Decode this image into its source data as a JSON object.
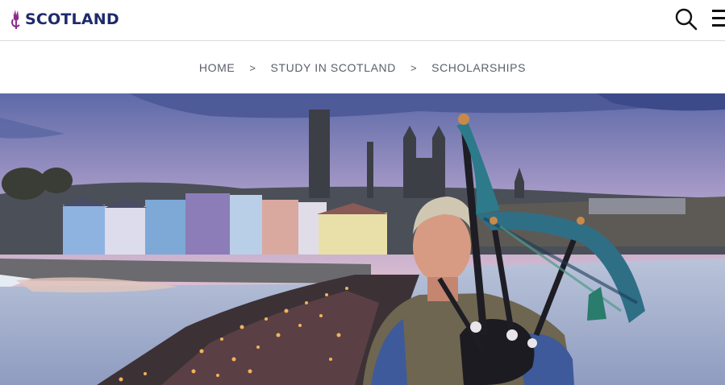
{
  "header": {
    "logo_text": "SCOTLAND",
    "brand_color": "#1f2a6b",
    "thistle_color": "#8b2c8f",
    "search_icon": "search-icon",
    "menu_icon": "hamburger-menu-icon"
  },
  "breadcrumb": {
    "items": [
      {
        "label": "HOME"
      },
      {
        "label": "STUDY IN SCOTLAND"
      },
      {
        "label": "SCHOLARSHIPS"
      }
    ],
    "separator": ">"
  }
}
